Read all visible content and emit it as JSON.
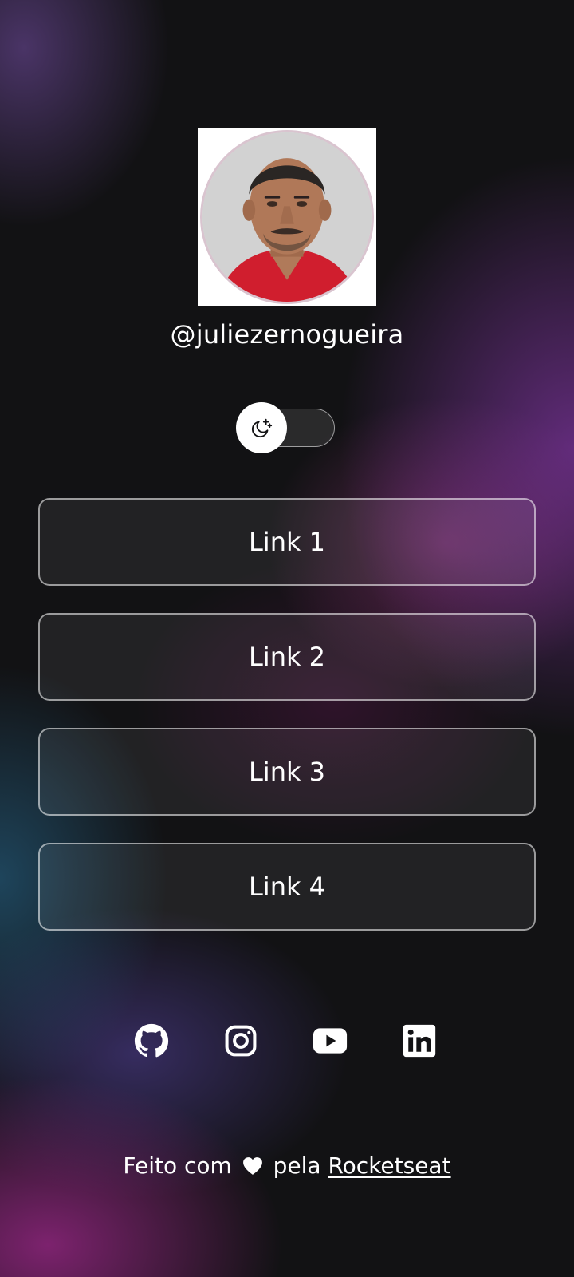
{
  "profile": {
    "username": "@juliezernogueira",
    "avatar_alt": "Foto de perfil"
  },
  "theme_switch": {
    "icon": "moon-stars-icon",
    "state": "dark"
  },
  "links": [
    {
      "label": "Link 1"
    },
    {
      "label": "Link 2"
    },
    {
      "label": "Link 3"
    },
    {
      "label": "Link 4"
    }
  ],
  "socials": [
    {
      "name": "github-icon"
    },
    {
      "name": "instagram-icon"
    },
    {
      "name": "youtube-icon"
    },
    {
      "name": "linkedin-icon"
    }
  ],
  "footer": {
    "prefix": "Feito com",
    "middle": "pela",
    "brand": "Rocketseat"
  },
  "colors": {
    "background": "#121214",
    "accent_purple": "#8b3fc0",
    "accent_pink": "#a0288c",
    "accent_teal": "#286e96"
  }
}
